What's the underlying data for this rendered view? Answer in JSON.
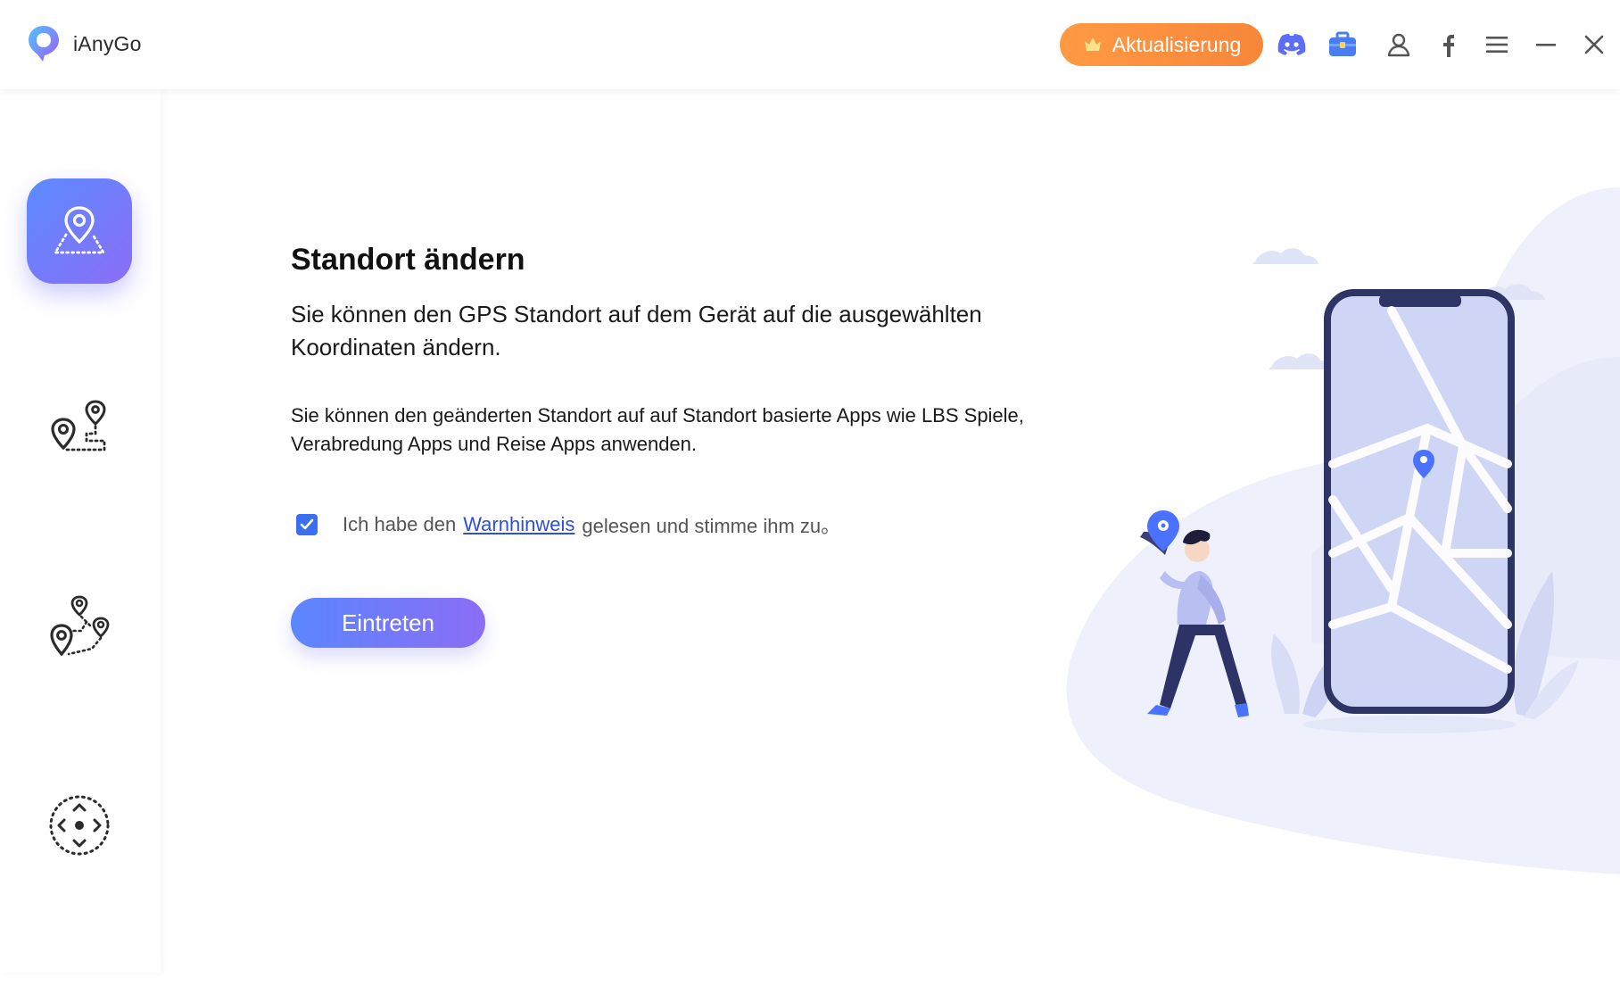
{
  "app": {
    "name": "iAnyGo"
  },
  "titlebar": {
    "update_label": "Aktualisierung",
    "icons": [
      "discord-icon",
      "toolbox-icon",
      "account-icon",
      "facebook-icon",
      "menu-icon",
      "minimize-icon",
      "close-icon"
    ]
  },
  "sidebar": {
    "items": [
      {
        "id": "change-location",
        "icon": "location-change-icon",
        "active": true
      },
      {
        "id": "two-spot-movement",
        "icon": "two-spot-route-icon",
        "active": false
      },
      {
        "id": "multi-spot-movement",
        "icon": "multi-spot-route-icon",
        "active": false
      },
      {
        "id": "joystick-movement",
        "icon": "joystick-icon",
        "active": false
      }
    ]
  },
  "main": {
    "title": "Standort ändern",
    "lead": "Sie können den GPS Standort auf dem Gerät auf die ausgewählten Koordinaten ändern.",
    "description": "Sie können den geänderten Standort auf auf Standort basierte Apps wie LBS Spiele, Verabredung Apps und Reise Apps anwenden.",
    "agreement": {
      "checked": true,
      "prefix": "Ich habe den",
      "link": "Warnhinweis",
      "suffix": "gelesen und stimme ihm zu。"
    },
    "enter_label": "Eintreten"
  },
  "colors": {
    "accent_start": "#5b86ff",
    "accent_end": "#8b6df5",
    "update_button": "#f8863a",
    "discord_icon": "#5b6ef5",
    "toolbox_icon": "#4a7cf2",
    "checkbox": "#3b6ff2",
    "link": "#2f4fd6"
  }
}
